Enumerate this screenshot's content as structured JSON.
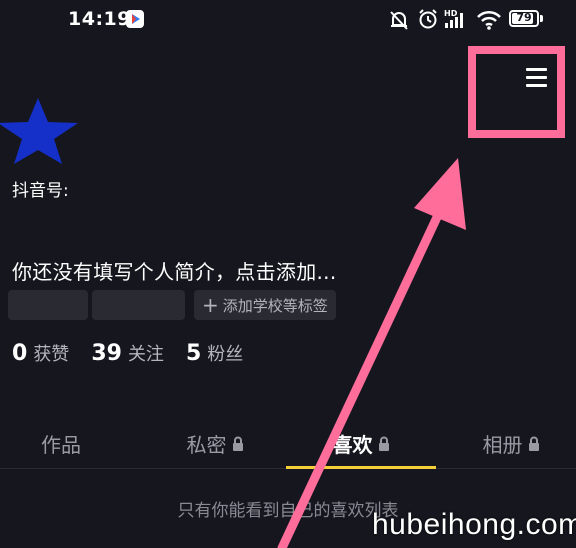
{
  "status_bar": {
    "time": "14:19",
    "battery": "79",
    "icons": [
      "app-badge-icon",
      "mute-icon",
      "alarm-icon",
      "hd-signal-icon",
      "wifi-icon",
      "battery-icon"
    ]
  },
  "header": {
    "menu_icon": "menu-icon"
  },
  "profile": {
    "avatar_icon": "star-icon",
    "douyin_id_label": "抖音号:",
    "bio": "你还没有填写个人简介，点击添加...",
    "add_tag_label": "添加学校等标签"
  },
  "stats": [
    {
      "value": "0",
      "label": "获赞"
    },
    {
      "value": "39",
      "label": "关注"
    },
    {
      "value": "5",
      "label": "粉丝"
    }
  ],
  "tabs": [
    {
      "label": "作品",
      "locked": false
    },
    {
      "label": "私密",
      "locked": true
    },
    {
      "label": "喜欢",
      "locked": true,
      "active": true
    },
    {
      "label": "相册",
      "locked": true
    }
  ],
  "empty_note": "只有你能看到自己的喜欢列表",
  "watermark": "hubeihong.com",
  "colors": {
    "background": "#16161f",
    "highlight": "#ff6e9b",
    "tab_indicator": "#f4cf3a",
    "star": "#1530c8"
  }
}
